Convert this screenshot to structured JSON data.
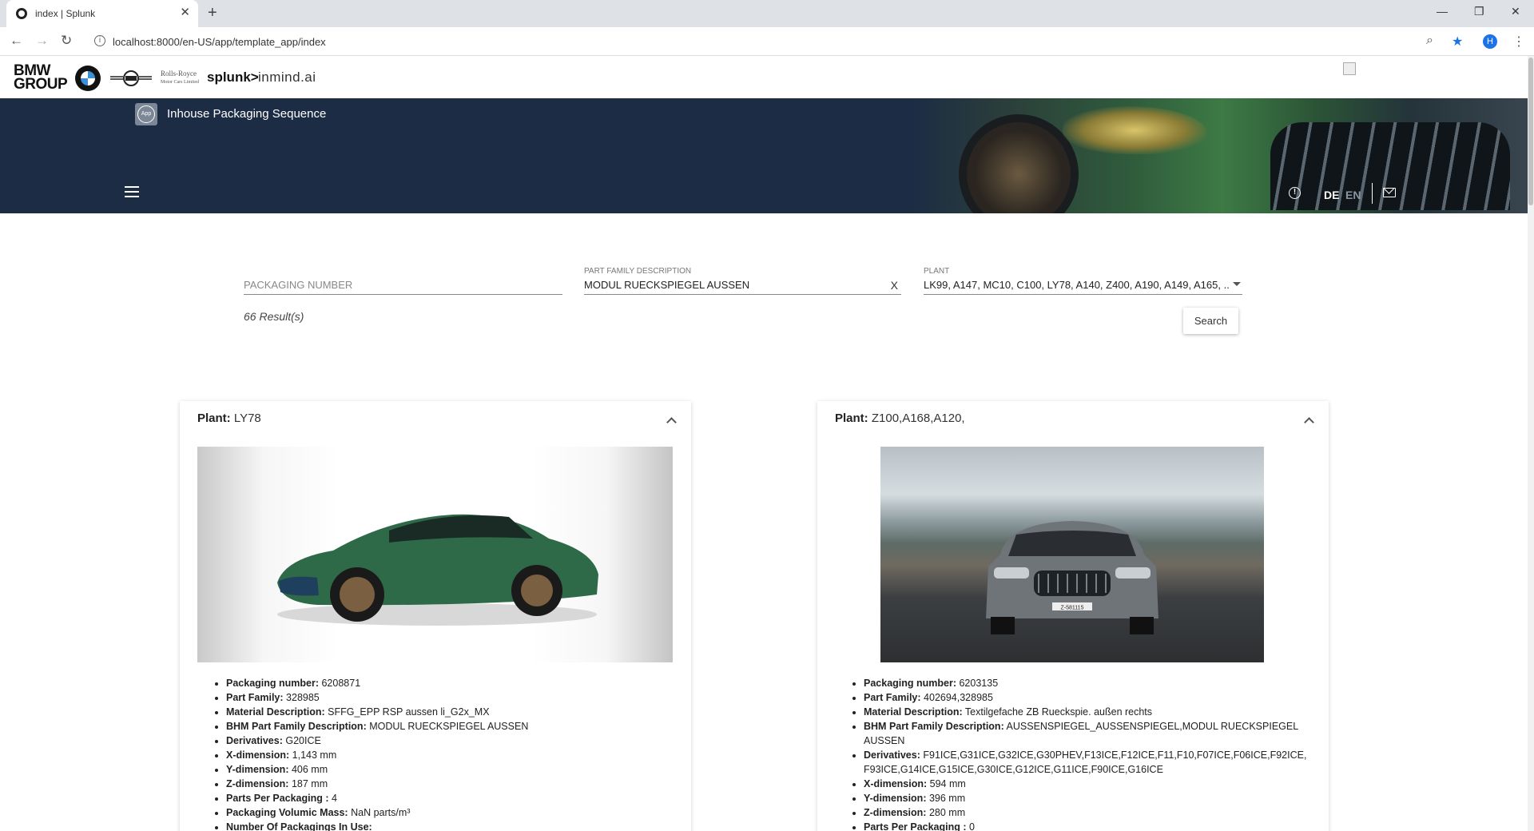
{
  "browser": {
    "tab_title": "index | Splunk",
    "url": "localhost:8000/en-US/app/template_app/index"
  },
  "brands": {
    "bmw_group": "BMW\nGROUP",
    "rolls_royce": "Rolls-Royce",
    "rolls_royce_sub": "Motor Cars Limited",
    "splunk": "splunk>",
    "inmind": "inmind.ai"
  },
  "header": {
    "app_badge": "App",
    "app_title": "Inhouse Packaging Sequence",
    "lang_de": "DE",
    "lang_en": "EN"
  },
  "search": {
    "packaging_number": {
      "placeholder": "PACKAGING NUMBER",
      "value": ""
    },
    "part_family": {
      "label": "PART FAMILY DESCRIPTION",
      "value": "MODUL RUECKSPIEGEL AUSSEN",
      "clear": "X"
    },
    "plant": {
      "label": "PLANT",
      "value": "LK99, A147, MC10, C100, LY78, A140, Z400, A190, A149, A165, ..."
    },
    "result_count": "66 Result(s)",
    "search_label": "Search"
  },
  "cards": [
    {
      "plant_label": "Plant:",
      "plant": "LY78",
      "details": [
        {
          "label": "Packaging number:",
          "value": "6208871"
        },
        {
          "label": "Part Family:",
          "value": "328985"
        },
        {
          "label": "Material Description:",
          "value": "SFFG_EPP RSP aussen li_G2x_MX"
        },
        {
          "label": "BHM Part Family Description:",
          "value": "MODUL RUECKSPIEGEL AUSSEN"
        },
        {
          "label": "Derivatives:",
          "value": "G20ICE"
        },
        {
          "label": "X-dimension:",
          "value": "1,143 mm"
        },
        {
          "label": "Y-dimension:",
          "value": "406 mm"
        },
        {
          "label": "Z-dimension:",
          "value": "187 mm"
        },
        {
          "label": "Parts Per Packaging :",
          "value": "4"
        },
        {
          "label": "Packaging Volumic Mass:",
          "value": "NaN parts/m³"
        },
        {
          "label": "Number Of Packagings In Use:",
          "value": ""
        }
      ]
    },
    {
      "plant_label": "Plant:",
      "plant": "Z100,A168,A120,",
      "plate": "Z-581115",
      "details": [
        {
          "label": "Packaging number:",
          "value": "6203135"
        },
        {
          "label": "Part Family:",
          "value": "402694,328985"
        },
        {
          "label": "Material Description:",
          "value": "Textilgefache ZB Rueckspie. außen rechts"
        },
        {
          "label": "BHM Part Family Description:",
          "value": "AUSSENSPIEGEL_AUSSENSPIEGEL,MODUL RUECKSPIEGEL AUSSEN"
        },
        {
          "label": "Derivatives:",
          "value": "F91ICE,G31ICE,G32ICE,G30PHEV,F13ICE,F12ICE,F11,F10,F07ICE,F06ICE,F92ICE,F93ICE,G14ICE,G15ICE,G30ICE,G12ICE,G11ICE,F90ICE,G16ICE"
        },
        {
          "label": "X-dimension:",
          "value": "594 mm"
        },
        {
          "label": "Y-dimension:",
          "value": "396 mm"
        },
        {
          "label": "Z-dimension:",
          "value": "280 mm"
        },
        {
          "label": "Parts Per Packaging :",
          "value": "0"
        }
      ]
    }
  ],
  "colors": {
    "header_bg": "#1c2c45",
    "accent_blue": "#1a73e8"
  }
}
